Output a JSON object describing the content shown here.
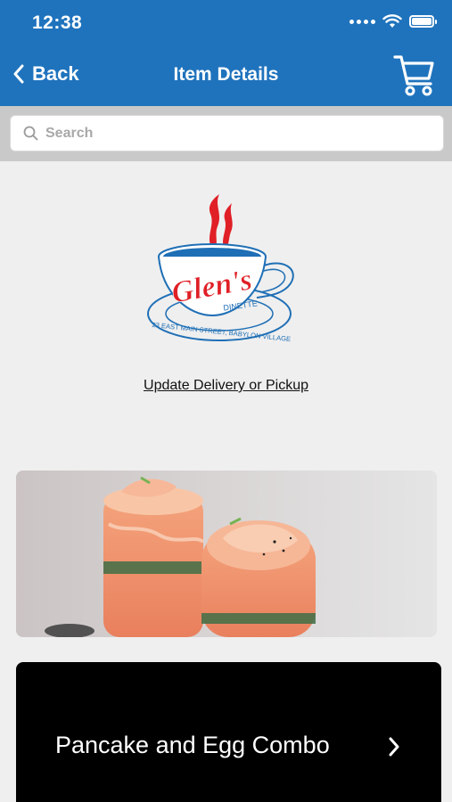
{
  "status_bar": {
    "time": "12:38"
  },
  "header": {
    "back_label": "Back",
    "title": "Item Details"
  },
  "search": {
    "placeholder": "Search"
  },
  "logo": {
    "name": "Glen's",
    "sub": "DINETTE",
    "address": "23 EAST MAIN STREET, BABYLON VILLAGE"
  },
  "delivery_link": "Update Delivery or Pickup",
  "item": {
    "name": "Pancake and Egg Combo"
  },
  "colors": {
    "header_bg": "#1f73bd",
    "page_bg": "#efefef",
    "card_bg": "#000000",
    "logo_red": "#e01f26",
    "logo_blue": "#1f6fb6"
  }
}
